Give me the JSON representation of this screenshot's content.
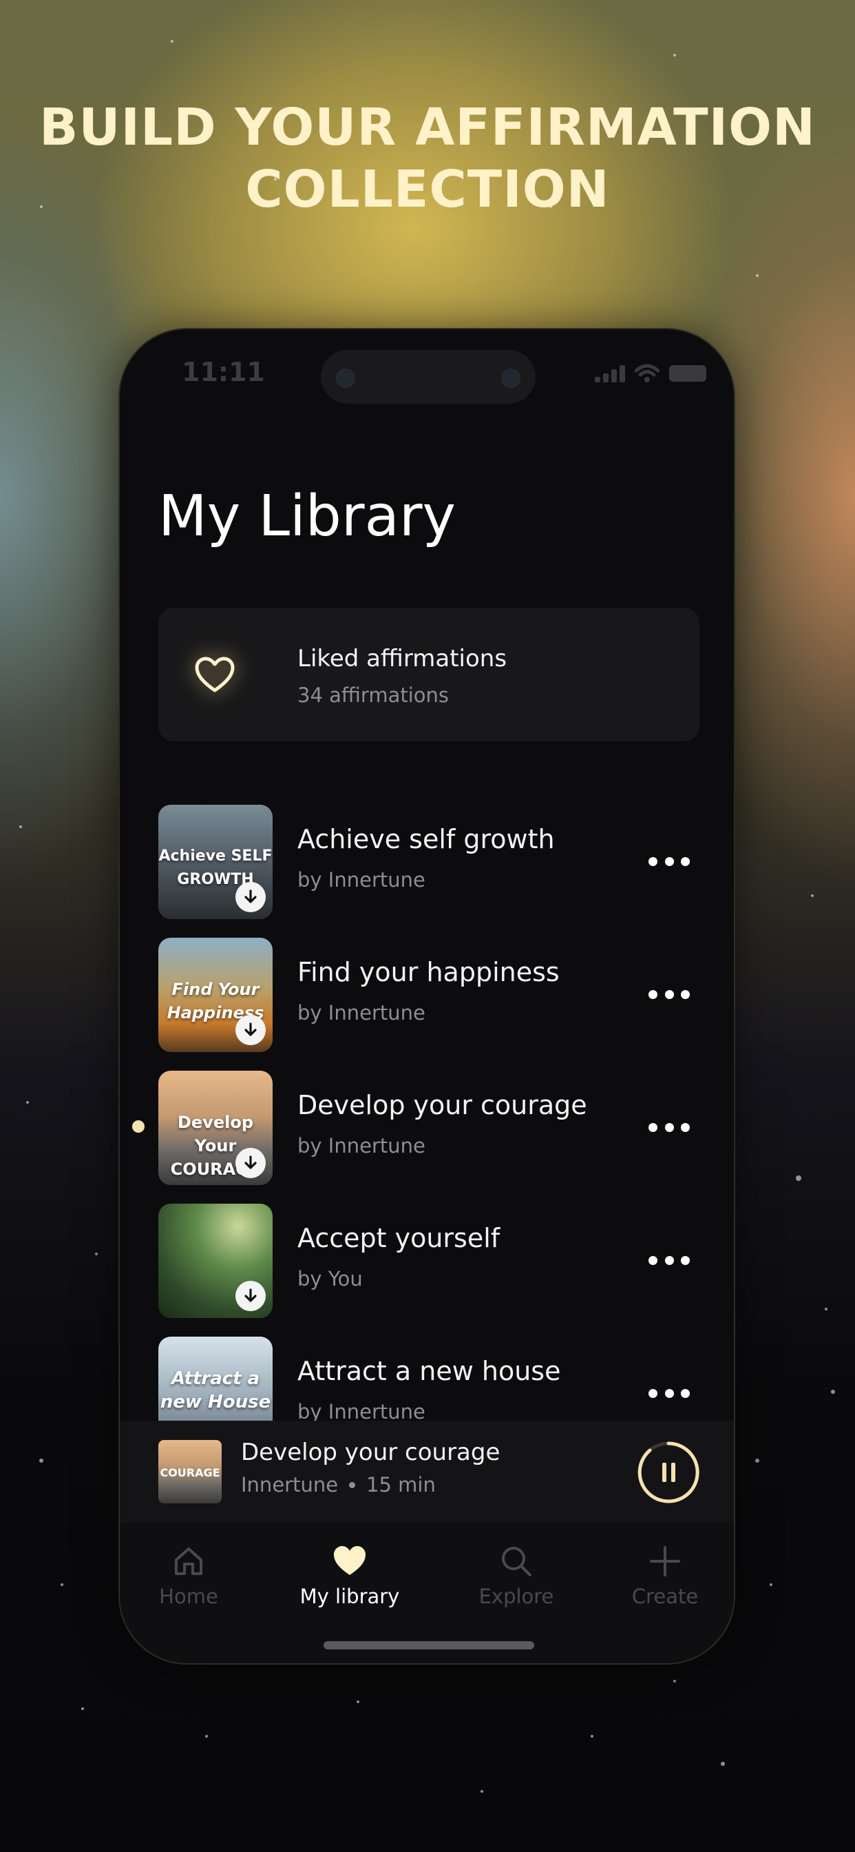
{
  "headline": {
    "line1": "BUILD YOUR AFFIRMATION",
    "line2": "COLLECTION"
  },
  "status_bar": {
    "time": "11:11"
  },
  "page": {
    "title": "My Library"
  },
  "liked": {
    "title": "Liked affirmations",
    "subtitle": "34 affirmations"
  },
  "library_items": [
    {
      "title": "Achieve self growth",
      "author": "by Innertune",
      "thumb_caption": "Achieve SELF GROWTH",
      "downloaded": true
    },
    {
      "title": "Find your happiness",
      "author": "by Innertune",
      "thumb_caption": "Find Your Happiness",
      "downloaded": true
    },
    {
      "title": "Develop your courage",
      "author": "by Innertune",
      "thumb_caption": "Develop Your COURAGE",
      "downloaded": true,
      "now_playing": true
    },
    {
      "title": "Accept yourself",
      "author": "by You",
      "thumb_caption": "",
      "downloaded": true
    },
    {
      "title": "Attract a new house",
      "author": "by Innertune",
      "thumb_caption": "Attract a new House",
      "downloaded": false
    }
  ],
  "mini_player": {
    "title": "Develop your courage",
    "artist": "Innertune",
    "duration": "15 min",
    "thumb_caption": "COURAGE",
    "state": "playing"
  },
  "tabs": [
    {
      "label": "Home",
      "icon": "home-icon",
      "active": false
    },
    {
      "label": "My library",
      "icon": "heart-icon",
      "active": true
    },
    {
      "label": "Explore",
      "icon": "search-icon",
      "active": false
    },
    {
      "label": "Create",
      "icon": "plus-icon",
      "active": false
    }
  ],
  "colors": {
    "accent": "#f4e2b0",
    "background": "#0c0c0e",
    "card": "#18181a",
    "muted_text": "#8e8e92"
  }
}
